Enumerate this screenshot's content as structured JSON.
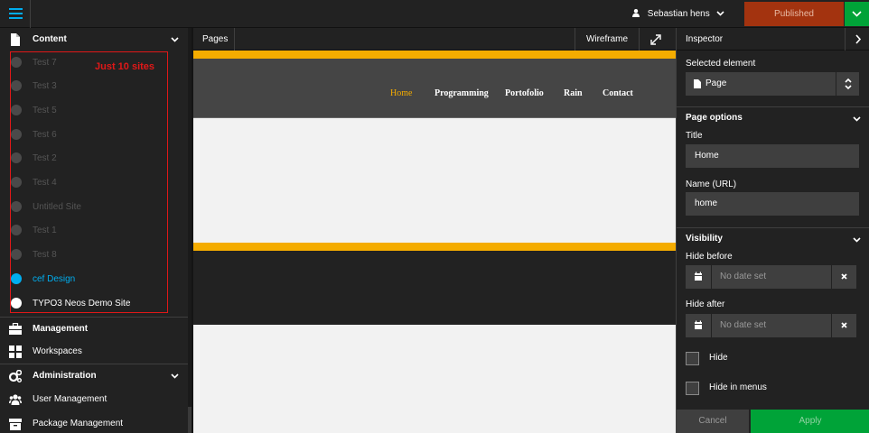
{
  "topbar": {
    "user_name": "Sebastian hens",
    "publish_label": "Published"
  },
  "sidebar": {
    "content_label": "Content",
    "sites": [
      {
        "label": "Test 7",
        "state": "dim"
      },
      {
        "label": "Test 3",
        "state": "dim"
      },
      {
        "label": "Test 5",
        "state": "dim"
      },
      {
        "label": "Test 6",
        "state": "dim"
      },
      {
        "label": "Test 2",
        "state": "dim"
      },
      {
        "label": "Test 4",
        "state": "dim"
      },
      {
        "label": "Untitled Site",
        "state": "dim"
      },
      {
        "label": "Test 1",
        "state": "dim"
      },
      {
        "label": "Test 8",
        "state": "dim"
      },
      {
        "label": "cef Design",
        "state": "active"
      },
      {
        "label": "TYPO3 Neos Demo Site",
        "state": "normal"
      }
    ],
    "annotation": "Just 10 sites",
    "management_label": "Management",
    "workspaces_label": "Workspaces",
    "administration_label": "Administration",
    "user_management_label": "User Management",
    "package_management_label": "Package Management"
  },
  "center": {
    "pages_label": "Pages",
    "wireframe_label": "Wireframe",
    "nav_links": [
      "Home",
      "Programming",
      "Portofolio",
      "Rain",
      "Contact"
    ],
    "active_nav": "Home"
  },
  "inspector": {
    "title": "Inspector",
    "selected_element_label": "Selected element",
    "selected_element_value": "Page",
    "page_options_label": "Page options",
    "title_label": "Title",
    "title_value": "Home",
    "name_url_label": "Name (URL)",
    "name_url_value": "home",
    "visibility_label": "Visibility",
    "hide_before_label": "Hide before",
    "hide_before_placeholder": "No date set",
    "hide_after_label": "Hide after",
    "hide_after_placeholder": "No date set",
    "hide_label": "Hide",
    "hide_in_menus_label": "Hide in menus",
    "cancel_label": "Cancel",
    "apply_label": "Apply"
  },
  "colors": {
    "accent_blue": "#00adee",
    "published_red": "#a3330f",
    "apply_green": "#00a338",
    "site_orange": "#f4ac00",
    "annotation_red": "#e01818"
  }
}
